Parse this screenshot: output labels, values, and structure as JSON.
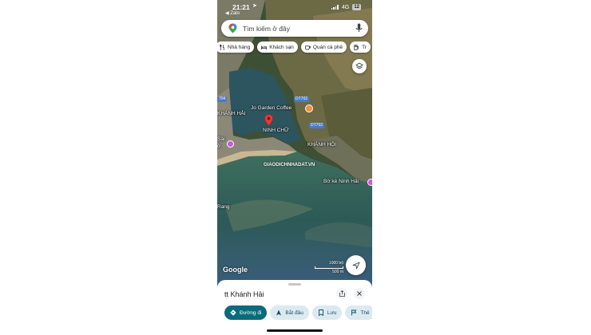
{
  "status_bar": {
    "time": "21:21",
    "back_label": "◀ Zalo",
    "network": "4G",
    "battery": "12"
  },
  "search": {
    "placeholder": "Tìm kiếm ở đây"
  },
  "chips": [
    {
      "label": "Nhà hàng",
      "icon": "fork-knife-icon"
    },
    {
      "label": "Khách sạn",
      "icon": "bed-icon"
    },
    {
      "label": "Quán cà phê",
      "icon": "coffee-cup-icon"
    },
    {
      "label": "Tr",
      "icon": "gas-pump-icon"
    }
  ],
  "map": {
    "labels": {
      "jo_garden": "Jo Garden Coffee",
      "khanh_hai": "KHÁNH HẢI",
      "ninh_chu": "NINH CHỮ",
      "khanh_hoi": "KHÁNH HỘI",
      "bo_ke": "Bờ kè Ninh Hải",
      "sai": "Sài",
      "ru": "ờ",
      "rang": "Rang",
      "road_dt702_a": "DT702",
      "road_dt702_b": "DT702",
      "road_704": "704",
      "watermark": "GIAODICHNHADAT.VN"
    },
    "attribution": "Google",
    "scale_top": "1000 bộ",
    "scale_bottom": "500 m"
  },
  "sheet": {
    "place_name": "tt Khánh Hải",
    "actions": [
      {
        "label": "Đường đi",
        "icon": "directions-icon"
      },
      {
        "label": "Bắt đầu",
        "icon": "navigation-arrow-icon"
      },
      {
        "label": "Lưu",
        "icon": "bookmark-icon"
      },
      {
        "label": "Thê",
        "icon": "flag-icon"
      }
    ]
  },
  "colors": {
    "primary_action": "#0b6b7a",
    "secondary_action": "#dceaf0",
    "pin_red": "#e53935",
    "coffee_orange": "#f0913d",
    "poi_purple": "#c85bd6"
  }
}
